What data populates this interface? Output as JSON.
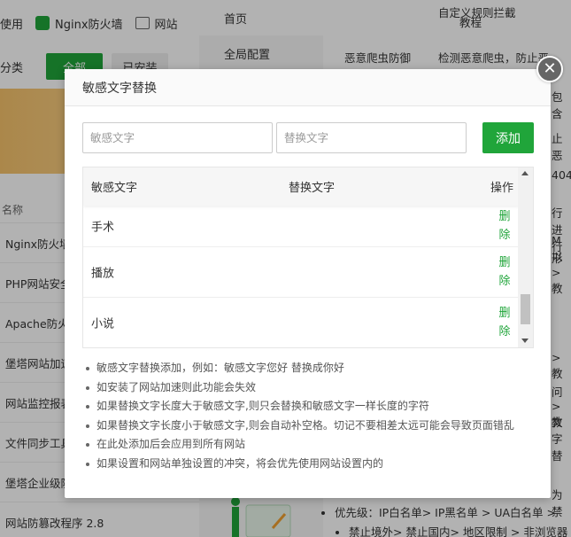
{
  "background": {
    "topbar": {
      "item1": "使用",
      "item2": "Nginx防火墙",
      "item3": "网站"
    },
    "category": {
      "label": "分类",
      "all_button": "全部",
      "other_button": "已安装"
    },
    "list_header": "名称",
    "plugins": [
      "Nginx防火墙",
      "PHP网站安全",
      "Apache防火",
      "堡塔网站加速",
      "网站监控报表",
      "文件同步工具",
      "堡塔企业级防",
      "网站防篡改程序 2.8"
    ],
    "nav": [
      "首页",
      "全局配置"
    ],
    "right_rows": [
      {
        "c1": "",
        "c2": "自定义规则拦截"
      },
      {
        "c1": "",
        "c2": "教程"
      },
      {
        "c1": "恶意爬虫防御",
        "c2": "检测恶意爬虫，防止恶"
      }
    ],
    "right_fragments": [
      "包含",
      "止恶",
      "404",
      "行进行",
      "M以",
      "形 >教",
      "> 教",
      "问 >教",
      "文字替",
      "为禁"
    ],
    "footer_list": [
      "优先级：IP白名单> IP黑名单 > UA白名单 >",
      "禁止境外> 禁止国内> 地区限制 > 非浏览器"
    ]
  },
  "modal": {
    "title": "敏感文字替换",
    "sensitive_placeholder": "敏感文字",
    "replace_placeholder": "替换文字",
    "add_button": "添加",
    "close_symbol": "✕",
    "table": {
      "columns": [
        "敏感文字",
        "替换文字",
        "操作"
      ],
      "rows": [
        {
          "word": "手术",
          "replace": "",
          "action": "删除"
        },
        {
          "word": "播放",
          "replace": "",
          "action": "删除"
        },
        {
          "word": "小说",
          "replace": "",
          "action": "删除"
        }
      ]
    },
    "notes": [
      "敏感文字替换添加，例如：敏感文字您好 替换成你好",
      "如安装了网站加速则此功能会失效",
      "如果替换文字长度大于敏感文字,则只会替换和敏感文字一样长度的字符",
      "如果替换文字长度小于敏感文字,则会自动补空格。切记不要相差太远可能会导致页面错乱",
      "在此处添加后会应用到所有网站",
      "如果设置和网站单独设置的冲突，将会优先使用网站设置内的"
    ]
  },
  "colors": {
    "accent_green": "#20a53a",
    "overlay": "rgba(0,0,0,0.30)"
  }
}
